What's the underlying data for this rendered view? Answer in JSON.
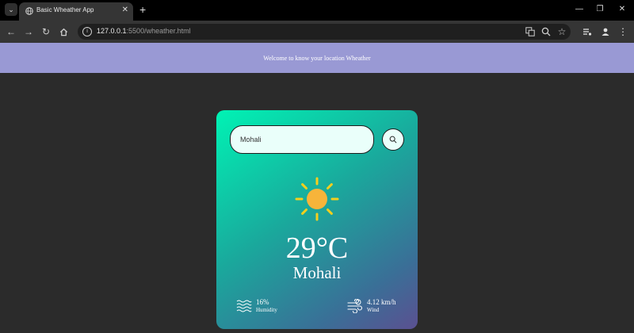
{
  "browser": {
    "tab_title": "Basic Wheather App",
    "url_host": "127.0.0.1",
    "url_path": ":5500/wheather.html"
  },
  "page": {
    "banner_text": "Welcome to know your location Wheather"
  },
  "weather": {
    "search_value": "Mohali",
    "temperature": "29°C",
    "city": "Mohali",
    "humidity_value": "16%",
    "humidity_label": "Humidity",
    "wind_value": "4.12 km/h",
    "wind_label": "Wind"
  },
  "icons": {
    "weather": "sun-icon",
    "humidity": "waves-icon",
    "wind": "wind-icon",
    "search": "search-icon"
  },
  "colors": {
    "banner": "#9999d4",
    "background": "#2b2b2b",
    "card_gradient_start": "#00f3b4",
    "card_gradient_end": "#5b5091",
    "sun_core": "#f7b43a",
    "sun_rays": "#f5cf1d"
  }
}
